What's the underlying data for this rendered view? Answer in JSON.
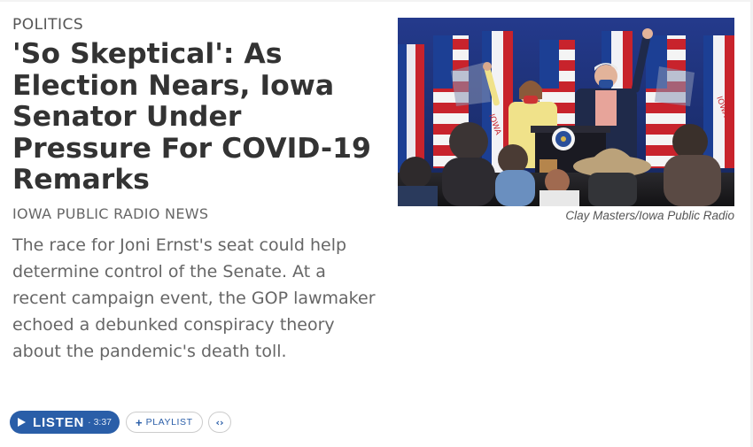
{
  "story": {
    "slug": "Politics",
    "headline": "'So Skeptical': As Election Nears, Iowa Senator Under Pressure For COVID-19 Remarks",
    "source": "IOWA PUBLIC RADIO NEWS",
    "teaser": "The race for Joni Ernst's seat could help determine control of the Senate. At a recent campaign event, the GOP lawmaker echoed a debunked conspiracy theory about the pandemic's death toll."
  },
  "image": {
    "credit": "Clay Masters/Iowa Public Radio",
    "flag_text": "IOWA"
  },
  "audio": {
    "listen_label": "LISTEN",
    "duration": "3:37",
    "playlist_label": "PLAYLIST",
    "embed_glyph": "‹›"
  },
  "colors": {
    "accent": "#2a5ea8",
    "headline": "#333333",
    "body": "#666666"
  }
}
